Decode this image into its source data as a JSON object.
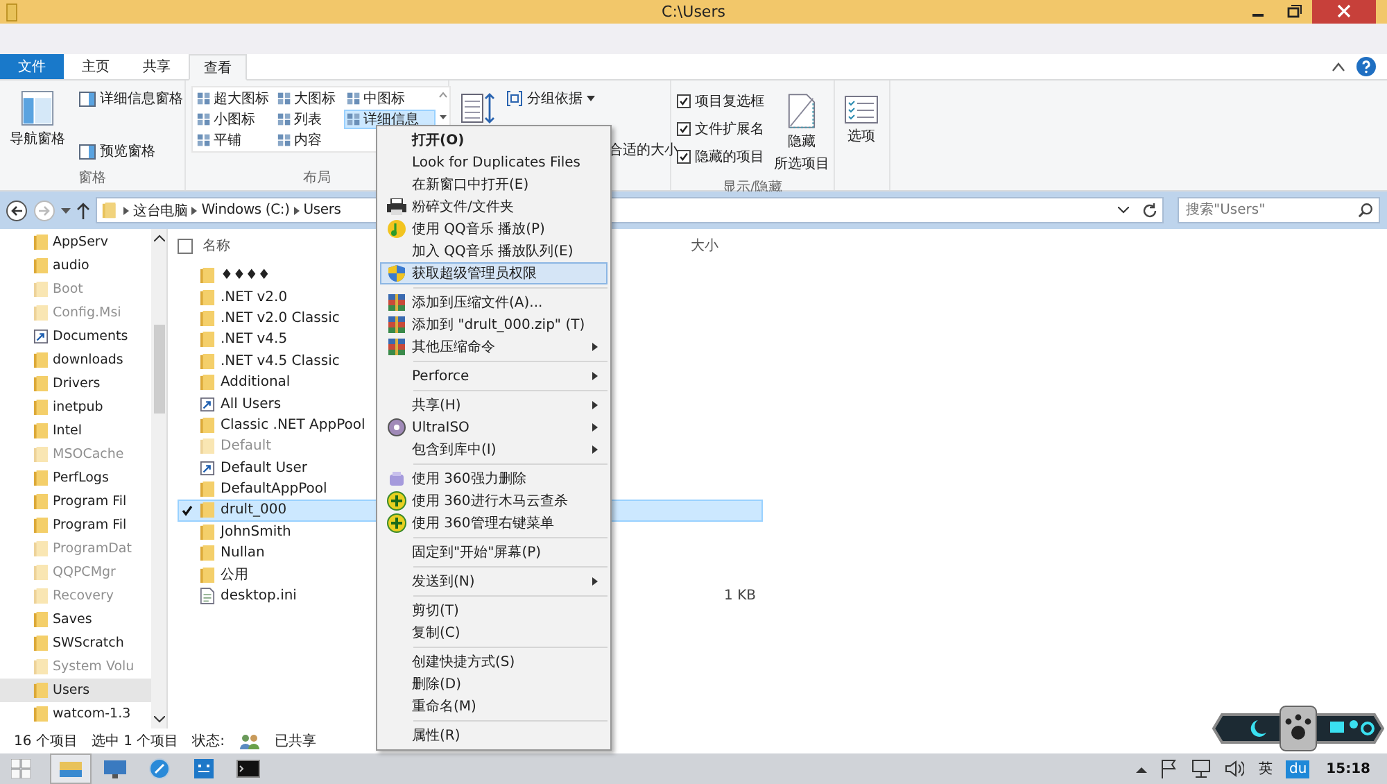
{
  "window": {
    "title": "C:\\Users"
  },
  "ribbon_tabs": [
    {
      "label": "文件",
      "kind": "file",
      "selected": false
    },
    {
      "label": "主页",
      "kind": "tab",
      "selected": false
    },
    {
      "label": "共享",
      "kind": "tab",
      "selected": false
    },
    {
      "label": "查看",
      "kind": "tab",
      "selected": true
    }
  ],
  "panes": {
    "label": "窗格",
    "nav": "导航窗格",
    "preview": "预览窗格",
    "details": "详细信息窗格"
  },
  "layout": {
    "label": "布局",
    "options": [
      {
        "label": "超大图标",
        "selected": false
      },
      {
        "label": "大图标",
        "selected": false
      },
      {
        "label": "中图标",
        "selected": false
      },
      {
        "label": "小图标",
        "selected": false
      },
      {
        "label": "列表",
        "selected": false
      },
      {
        "label": "详细信息",
        "selected": true
      },
      {
        "label": "平铺",
        "selected": false
      },
      {
        "label": "内容",
        "selected": false
      }
    ]
  },
  "current_view": {
    "group_by": "分组依据",
    "fit": "合适的大小"
  },
  "show_hide": {
    "label": "显示/隐藏",
    "checks": [
      {
        "label": "项目复选框",
        "checked": true
      },
      {
        "label": "文件扩展名",
        "checked": true
      },
      {
        "label": "隐藏的项目",
        "checked": true
      }
    ],
    "hide_selected": [
      "隐藏",
      "所选项目"
    ]
  },
  "options": "选项",
  "address": {
    "crumbs": [
      "这台电脑",
      "Windows (C:)",
      "Users"
    ],
    "search_placeholder": "搜索\"Users\""
  },
  "nav": [
    {
      "label": "AppServ",
      "kind": "folder",
      "hidden": false,
      "selected": false
    },
    {
      "label": "audio",
      "kind": "folder",
      "hidden": false,
      "selected": false
    },
    {
      "label": "Boot",
      "kind": "folder",
      "hidden": true,
      "selected": false
    },
    {
      "label": "Config.Msi",
      "kind": "folder",
      "hidden": true,
      "selected": false
    },
    {
      "label": "Documents",
      "kind": "shortcut",
      "hidden": false,
      "selected": false
    },
    {
      "label": "downloads",
      "kind": "folder",
      "hidden": false,
      "selected": false
    },
    {
      "label": "Drivers",
      "kind": "folder",
      "hidden": false,
      "selected": false
    },
    {
      "label": "inetpub",
      "kind": "folder",
      "hidden": false,
      "selected": false
    },
    {
      "label": "Intel",
      "kind": "folder",
      "hidden": false,
      "selected": false
    },
    {
      "label": "MSOCache",
      "kind": "folder",
      "hidden": true,
      "selected": false
    },
    {
      "label": "PerfLogs",
      "kind": "folder",
      "hidden": false,
      "selected": false
    },
    {
      "label": "Program Fil",
      "kind": "folder",
      "hidden": false,
      "selected": false
    },
    {
      "label": "Program Fil",
      "kind": "folder",
      "hidden": false,
      "selected": false
    },
    {
      "label": "ProgramDat",
      "kind": "folder",
      "hidden": true,
      "selected": false
    },
    {
      "label": "QQPCMgr",
      "kind": "folder",
      "hidden": true,
      "selected": false
    },
    {
      "label": "Recovery",
      "kind": "folder",
      "hidden": true,
      "selected": false
    },
    {
      "label": "Saves",
      "kind": "folder",
      "hidden": false,
      "selected": false
    },
    {
      "label": "SWScratch",
      "kind": "folder",
      "hidden": false,
      "selected": false
    },
    {
      "label": "System Volu",
      "kind": "folder",
      "hidden": true,
      "selected": false
    },
    {
      "label": "Users",
      "kind": "folder",
      "hidden": false,
      "selected": true
    },
    {
      "label": "watcom-1.3",
      "kind": "folder",
      "hidden": false,
      "selected": false
    }
  ],
  "files": {
    "columns": [
      "名称",
      "大小"
    ],
    "header_checked": false,
    "rows": [
      {
        "name": "♦♦♦♦",
        "kind": "folder",
        "hidden": false,
        "selected": false
      },
      {
        "name": ".NET v2.0",
        "kind": "folder",
        "hidden": false,
        "selected": false
      },
      {
        "name": ".NET v2.0 Classic",
        "kind": "folder",
        "hidden": false,
        "selected": false
      },
      {
        "name": ".NET v4.5",
        "kind": "folder",
        "hidden": false,
        "selected": false
      },
      {
        "name": ".NET v4.5 Classic",
        "kind": "folder",
        "hidden": false,
        "selected": false
      },
      {
        "name": "Additional",
        "kind": "folder",
        "hidden": false,
        "selected": false
      },
      {
        "name": "All Users",
        "kind": "shortcut",
        "hidden": false,
        "selected": false
      },
      {
        "name": "Classic .NET AppPool",
        "kind": "folder",
        "hidden": false,
        "selected": false
      },
      {
        "name": "Default",
        "kind": "folder",
        "hidden": true,
        "selected": false
      },
      {
        "name": "Default User",
        "kind": "shortcut",
        "hidden": false,
        "selected": false
      },
      {
        "name": "DefaultAppPool",
        "kind": "folder",
        "hidden": false,
        "selected": false
      },
      {
        "name": "drult_000",
        "kind": "folder",
        "hidden": false,
        "selected": true
      },
      {
        "name": "JohnSmith",
        "kind": "folder",
        "hidden": false,
        "selected": false
      },
      {
        "name": "Nullan",
        "kind": "folder",
        "hidden": false,
        "selected": false
      },
      {
        "name": "公用",
        "kind": "folder",
        "hidden": false,
        "selected": false
      },
      {
        "name": "desktop.ini",
        "kind": "file",
        "hidden": false,
        "selected": false,
        "size": "1 KB"
      }
    ]
  },
  "context_menu": [
    {
      "kind": "plain",
      "label": "打开(O)",
      "default": true,
      "selected": false,
      "submenu": false
    },
    {
      "kind": "plain",
      "label": "Look for Duplicates Files",
      "default": false,
      "selected": false,
      "submenu": false
    },
    {
      "kind": "plain",
      "label": "在新窗口中打开(E)",
      "default": false,
      "selected": false,
      "submenu": false
    },
    {
      "kind": "printer",
      "label": "粉碎文件/文件夹",
      "default": false,
      "selected": false,
      "submenu": false
    },
    {
      "kind": "music",
      "label": "使用 QQ音乐 播放(P)",
      "default": false,
      "selected": false,
      "submenu": false
    },
    {
      "kind": "plain",
      "label": "加入 QQ音乐 播放队列(E)",
      "default": false,
      "selected": false,
      "submenu": false
    },
    {
      "kind": "shield",
      "label": "获取超级管理员权限",
      "default": false,
      "selected": true,
      "submenu": false
    },
    {
      "kind": "separator"
    },
    {
      "kind": "archive",
      "label": "添加到压缩文件(A)...",
      "default": false,
      "selected": false,
      "submenu": false
    },
    {
      "kind": "archive",
      "label": "添加到 \"drult_000.zip\" (T)",
      "default": false,
      "selected": false,
      "submenu": false
    },
    {
      "kind": "archive",
      "label": "其他压缩命令",
      "default": false,
      "selected": false,
      "submenu": true
    },
    {
      "kind": "separator"
    },
    {
      "kind": "plain",
      "label": "Perforce",
      "default": false,
      "selected": false,
      "submenu": true
    },
    {
      "kind": "separator"
    },
    {
      "kind": "plain",
      "label": "共享(H)",
      "default": false,
      "selected": false,
      "submenu": true
    },
    {
      "kind": "disc",
      "label": "UltraISO",
      "default": false,
      "selected": false,
      "submenu": true
    },
    {
      "kind": "plain",
      "label": "包含到库中(I)",
      "default": false,
      "selected": false,
      "submenu": true
    },
    {
      "kind": "separator"
    },
    {
      "kind": "eraser",
      "label": "使用 360强力删除",
      "default": false,
      "selected": false,
      "submenu": false
    },
    {
      "kind": "plus",
      "label": "使用 360进行木马云查杀",
      "default": false,
      "selected": false,
      "submenu": false
    },
    {
      "kind": "plus",
      "label": "使用 360管理右键菜单",
      "default": false,
      "selected": false,
      "submenu": false
    },
    {
      "kind": "separator"
    },
    {
      "kind": "plain",
      "label": "固定到\"开始\"屏幕(P)",
      "default": false,
      "selected": false,
      "submenu": false
    },
    {
      "kind": "separator"
    },
    {
      "kind": "plain",
      "label": "发送到(N)",
      "default": false,
      "selected": false,
      "submenu": true
    },
    {
      "kind": "separator"
    },
    {
      "kind": "plain",
      "label": "剪切(T)",
      "default": false,
      "selected": false,
      "submenu": false
    },
    {
      "kind": "plain",
      "label": "复制(C)",
      "default": false,
      "selected": false,
      "submenu": false
    },
    {
      "kind": "separator"
    },
    {
      "kind": "plain",
      "label": "创建快捷方式(S)",
      "default": false,
      "selected": false,
      "submenu": false
    },
    {
      "kind": "plain",
      "label": "删除(D)",
      "default": false,
      "selected": false,
      "submenu": false
    },
    {
      "kind": "plain",
      "label": "重命名(M)",
      "default": false,
      "selected": false,
      "submenu": false
    },
    {
      "kind": "separator"
    },
    {
      "kind": "plain",
      "label": "属性(R)",
      "default": false,
      "selected": false,
      "submenu": false
    }
  ],
  "status_bar": {
    "count": "16 个项目",
    "selection": "选中 1 个项目",
    "state_label": "状态:",
    "state": "已共享"
  },
  "taskbar": {
    "apps": [
      {
        "kind": "explorer",
        "active": true
      },
      {
        "kind": "remote",
        "active": false
      },
      {
        "kind": "browser",
        "active": false
      },
      {
        "kind": "messenger",
        "active": false
      },
      {
        "kind": "console",
        "active": false
      }
    ],
    "ime": "英",
    "du": "du",
    "time": "15:18"
  }
}
